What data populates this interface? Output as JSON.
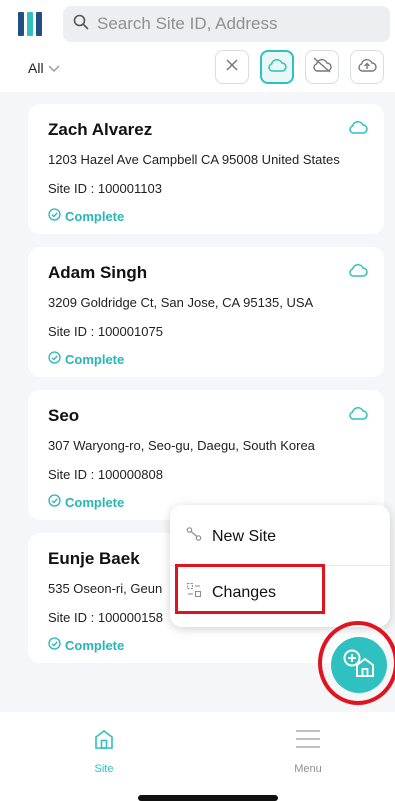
{
  "search": {
    "placeholder": "Search Site ID, Address"
  },
  "filter": {
    "selected": "All"
  },
  "sites": [
    {
      "name": "Zach Alvarez",
      "address": "1203 Hazel Ave Campbell CA 95008 United States",
      "site_id": "Site ID : 100001103",
      "status": "Complete"
    },
    {
      "name": "Adam Singh",
      "address": "3209 Goldridge Ct, San Jose, CA 95135, USA",
      "site_id": "Site ID : 100001075",
      "status": "Complete"
    },
    {
      "name": "Seo",
      "address": "307 Waryong-ro, Seo-gu, Daegu, South Korea",
      "site_id": "Site ID : 100000808",
      "status": "Complete"
    },
    {
      "name": "Eunje Baek",
      "address": "535 Oseon-ri, Geun",
      "site_id": "Site ID : 100000158",
      "status": "Complete"
    }
  ],
  "popup_menu": {
    "new_site": "New Site",
    "changes": "Changes"
  },
  "tabs": {
    "site": "Site",
    "menu": "Menu"
  },
  "colors": {
    "accent": "#2fc0c0",
    "highlight": "#e0141e"
  }
}
